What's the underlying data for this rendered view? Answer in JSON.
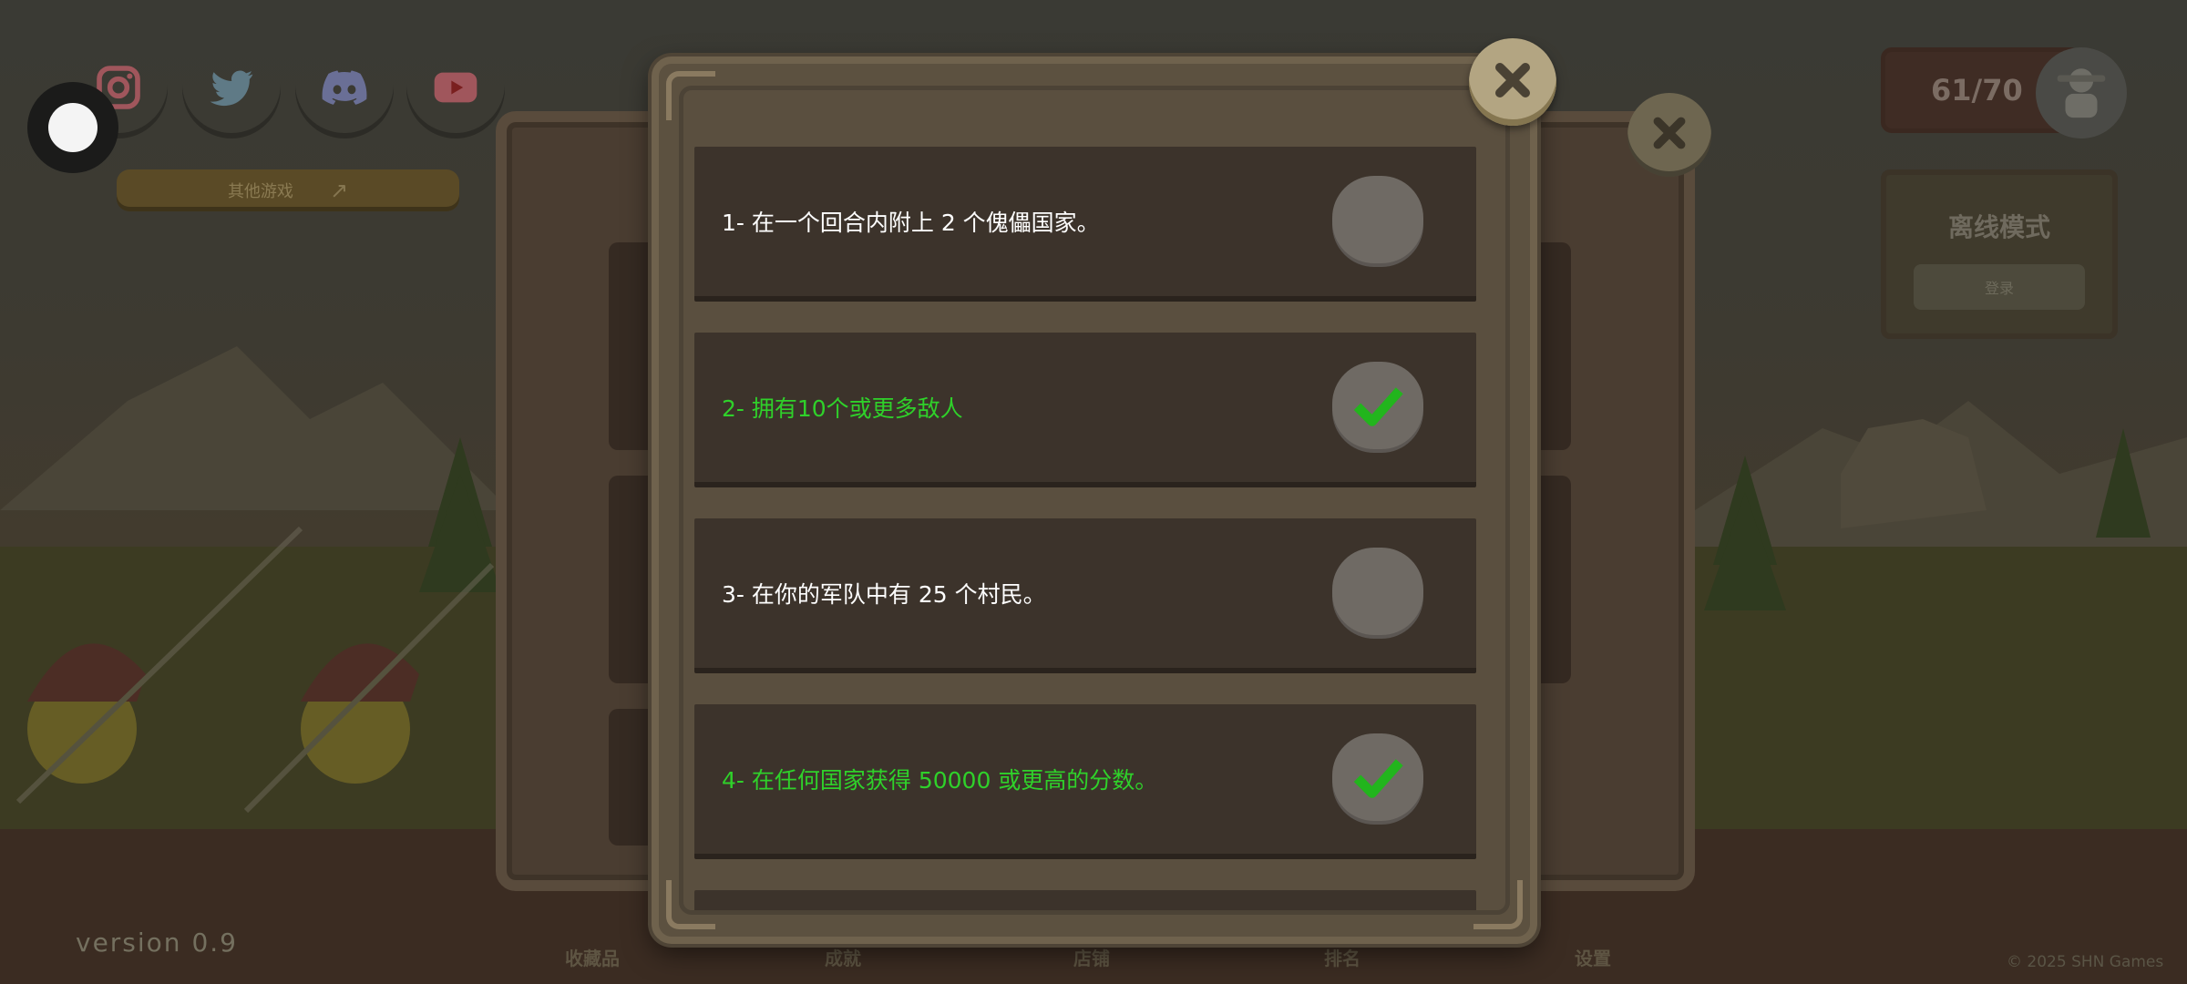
{
  "social": [
    {
      "name": "instagram-icon",
      "color": "#7a1f28"
    },
    {
      "name": "twitter-icon",
      "color": "#283a44"
    },
    {
      "name": "discord-icon",
      "color": "#2c3046"
    },
    {
      "name": "youtube-icon",
      "color": "#7a1f1f"
    }
  ],
  "other_games_label": "其他游戏",
  "score": "61/70",
  "offline": {
    "title": "离线模式",
    "button": "登录"
  },
  "version": "version 0.9",
  "copyright": "© 2025 SHN Games",
  "bottom_nav": [
    "收藏品",
    "成就",
    "店铺",
    "排名",
    "设置"
  ],
  "quests": [
    {
      "text": "1- 在一个回合内附上 2 个傀儡国家。",
      "completed": false
    },
    {
      "text": "2- 拥有10个或更多敌人",
      "completed": true
    },
    {
      "text": "3- 在你的军队中有 25 个村民。",
      "completed": false
    },
    {
      "text": "4- 在任何国家获得 50000 或更高的分数。",
      "completed": true
    }
  ],
  "colors": {
    "completed": "#2fd12a",
    "pending": "#ffffff",
    "check": "#22b51d"
  }
}
